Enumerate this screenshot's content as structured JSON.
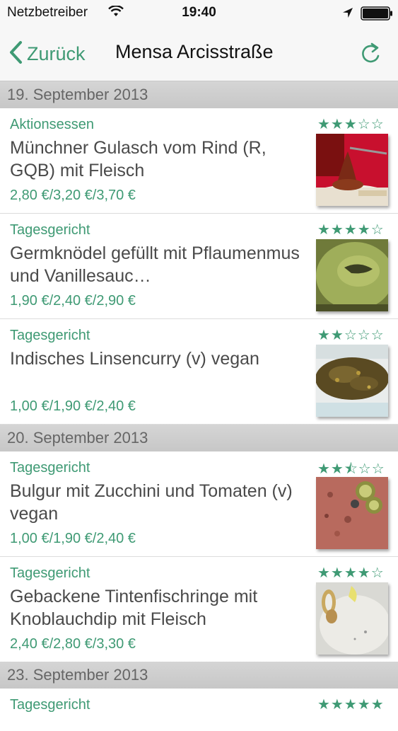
{
  "status_bar": {
    "carrier": "Netzbetreiber",
    "time": "19:40"
  },
  "nav": {
    "back_label": "Zurück",
    "title": "Mensa Arcisstraße"
  },
  "colors": {
    "accent": "#3f9a74",
    "section_bg": "#cfcfcf"
  },
  "sections": [
    {
      "date": "19. September 2013",
      "meals": [
        {
          "category": "Aktionsessen",
          "name": "Münchner Gulasch vom Rind (R, GQB) mit Fleisch",
          "price": "2,80 €/3,20 €/3,70 €",
          "rating_stars": 3,
          "rating_text": "★★★☆☆",
          "photo": "goulash-photo"
        },
        {
          "category": "Tagesgericht",
          "name": "Germknödel gefüllt mit Pflaumenmus und Vanillesauc…",
          "price": "1,90 €/2,40 €/2,90 €",
          "rating_stars": 4,
          "rating_text": "★★★★☆",
          "photo": "dumpling-photo"
        },
        {
          "category": "Tagesgericht",
          "name": "Indisches Linsencurry (v) vegan",
          "price": "1,00 €/1,90 €/2,40 €",
          "rating_stars": 2,
          "rating_text": "★★☆☆☆",
          "photo": "lentil-curry-photo"
        }
      ]
    },
    {
      "date": "20. September 2013",
      "meals": [
        {
          "category": "Tagesgericht",
          "name": "Bulgur mit Zucchini und Tomaten (v) vegan",
          "price": "1,00 €/1,90 €/2,40 €",
          "rating_stars": 2.5,
          "rating_text": "★★⯪☆☆",
          "photo": "bulgur-photo"
        },
        {
          "category": "Tagesgericht",
          "name": "Gebackene Tintenfischringe mit Knoblauchdip mit Fleisch",
          "price": "2,40 €/2,80 €/3,30 €",
          "rating_stars": 4,
          "rating_text": "★★★★☆",
          "photo": "calamari-photo"
        }
      ]
    },
    {
      "date": "23. September 2013",
      "meals": [
        {
          "category": "Tagesgericht",
          "rating_stars": 5,
          "rating_text": "★★★★★"
        }
      ]
    }
  ]
}
